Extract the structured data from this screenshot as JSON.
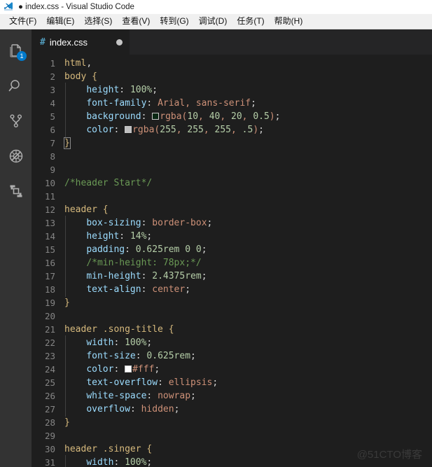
{
  "window": {
    "title": "● index.css - Visual Studio Code",
    "logo_icon": "vscode-logo"
  },
  "menubar": {
    "items": [
      {
        "label": "文件(F)"
      },
      {
        "label": "编辑(E)"
      },
      {
        "label": "选择(S)"
      },
      {
        "label": "查看(V)"
      },
      {
        "label": "转到(G)"
      },
      {
        "label": "调试(D)"
      },
      {
        "label": "任务(T)"
      },
      {
        "label": "帮助(H)"
      }
    ]
  },
  "activitybar": {
    "items": [
      {
        "name": "explorer",
        "icon": "files-icon",
        "badge": "1"
      },
      {
        "name": "search",
        "icon": "search-icon",
        "badge": ""
      },
      {
        "name": "source-control",
        "icon": "source-control-icon",
        "badge": ""
      },
      {
        "name": "debug",
        "icon": "debug-icon",
        "badge": ""
      },
      {
        "name": "extensions",
        "icon": "extensions-icon",
        "badge": ""
      }
    ],
    "badge_color": "#007acc"
  },
  "tabs": [
    {
      "icon": "#",
      "label": "index.css",
      "dirty": true
    }
  ],
  "editor": {
    "language": "css",
    "theme": "Dark+",
    "background": "#1e1e1e",
    "first_visible_line": 1,
    "last_visible_line": 31,
    "lines": [
      {
        "n": "1",
        "text": "html,"
      },
      {
        "n": "2",
        "text": "body {"
      },
      {
        "n": "3",
        "text": "    height: 100%;"
      },
      {
        "n": "4",
        "text": "    font-family: Arial, sans-serif;"
      },
      {
        "n": "5",
        "text": "    background: rgba(10, 40, 20, 0.5);"
      },
      {
        "n": "6",
        "text": "    color: rgba(255, 255, 255, .5);"
      },
      {
        "n": "7",
        "text": "}"
      },
      {
        "n": "8",
        "text": ""
      },
      {
        "n": "9",
        "text": ""
      },
      {
        "n": "10",
        "text": "/*header Start*/"
      },
      {
        "n": "11",
        "text": ""
      },
      {
        "n": "12",
        "text": "header {"
      },
      {
        "n": "13",
        "text": "    box-sizing: border-box;"
      },
      {
        "n": "14",
        "text": "    height: 14%;"
      },
      {
        "n": "15",
        "text": "    padding: 0.625rem 0 0;"
      },
      {
        "n": "16",
        "text": "    /*min-height: 78px;*/"
      },
      {
        "n": "17",
        "text": "    min-height: 2.4375rem;"
      },
      {
        "n": "18",
        "text": "    text-align: center;"
      },
      {
        "n": "19",
        "text": "}"
      },
      {
        "n": "20",
        "text": ""
      },
      {
        "n": "21",
        "text": "header .song-title {"
      },
      {
        "n": "22",
        "text": "    width: 100%;"
      },
      {
        "n": "23",
        "text": "    font-size: 0.625rem;"
      },
      {
        "n": "24",
        "text": "    color: #fff;"
      },
      {
        "n": "25",
        "text": "    text-overflow: ellipsis;"
      },
      {
        "n": "26",
        "text": "    white-space: nowrap;"
      },
      {
        "n": "27",
        "text": "    overflow: hidden;"
      },
      {
        "n": "28",
        "text": "}"
      },
      {
        "n": "29",
        "text": ""
      },
      {
        "n": "30",
        "text": "header .singer {"
      },
      {
        "n": "31",
        "text": "    width: 100%;"
      }
    ],
    "color_swatches": [
      {
        "line": "5",
        "value": "rgba(10, 40, 20, 0.5)",
        "hex": "#0a2814"
      },
      {
        "line": "6",
        "value": "rgba(255, 255, 255, .5)",
        "hex": "#bfbfbf"
      },
      {
        "line": "24",
        "value": "#fff",
        "hex": "#ffffff"
      }
    ]
  },
  "watermark": {
    "text": "@51CTO博客"
  }
}
